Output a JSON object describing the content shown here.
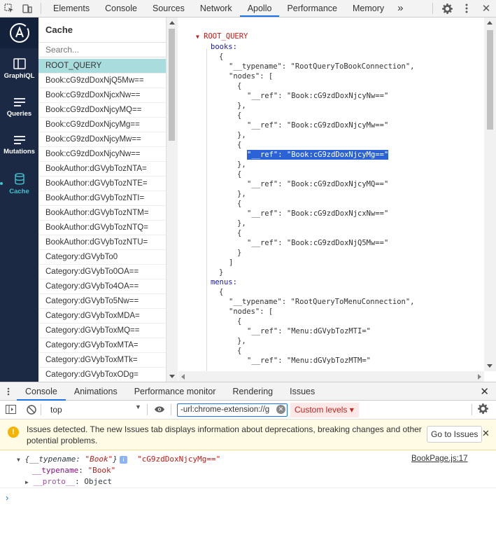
{
  "devtools": {
    "tabs": [
      "Elements",
      "Console",
      "Sources",
      "Network",
      "Apollo",
      "Performance",
      "Memory"
    ],
    "active_tab": "Apollo",
    "more_tabs": "»",
    "close": "✕"
  },
  "apollo_rail": {
    "items": [
      {
        "label": "GraphiQL",
        "icon": "graphiql-icon"
      },
      {
        "label": "Queries",
        "icon": "queries-icon"
      },
      {
        "label": "Mutations",
        "icon": "mutations-icon"
      },
      {
        "label": "Cache",
        "icon": "database-icon"
      }
    ],
    "active": "Cache"
  },
  "cache": {
    "title": "Cache",
    "search_placeholder": "Search...",
    "items": [
      "ROOT_QUERY",
      "Book:cG9zdDoxNjQ5Mw==",
      "Book:cG9zdDoxNjcxNw==",
      "Book:cG9zdDoxNjcyMQ==",
      "Book:cG9zdDoxNjcyMg==",
      "Book:cG9zdDoxNjcyMw==",
      "Book:cG9zdDoxNjcyNw==",
      "BookAuthor:dGVybTozNTA=",
      "BookAuthor:dGVybTozNTE=",
      "BookAuthor:dGVybTozNTI=",
      "BookAuthor:dGVybTozNTM=",
      "BookAuthor:dGVybTozNTQ=",
      "BookAuthor:dGVybTozNTU=",
      "Category:dGVybTo0",
      "Category:dGVybTo0OA==",
      "Category:dGVybTo4OA==",
      "Category:dGVybTo5Nw==",
      "Category:dGVybToxMDA=",
      "Category:dGVybToxMQ==",
      "Category:dGVybToxMTA=",
      "Category:dGVybToxMTk=",
      "Category:dGVybToxODg="
    ],
    "selected": "ROOT_QUERY"
  },
  "json_view": {
    "root": "ROOT_QUERY",
    "books_key": "books:",
    "books_typename": "\"__typename\": \"RootQueryToBookConnection\",",
    "nodes_key": "\"nodes\": [",
    "book_refs": [
      "\"__ref\": \"Book:cG9zdDoxNjcyNw==\"",
      "\"__ref\": \"Book:cG9zdDoxNjcyMw==\"",
      "\"__ref\": \"Book:cG9zdDoxNjcyMg==\"",
      "\"__ref\": \"Book:cG9zdDoxNjcyMQ==\"",
      "\"__ref\": \"Book:cG9zdDoxNjcxNw==\"",
      "\"__ref\": \"Book:cG9zdDoxNjQ5Mw==\""
    ],
    "highlighted_index": 2,
    "menus_key": "menus:",
    "menus_typename": "\"__typename\": \"RootQueryToMenuConnection\",",
    "menu_refs": [
      "\"__ref\": \"Menu:dGVybTozMTI=\"",
      "\"__ref\": \"Menu:dGVybTozMTM=\""
    ],
    "open_brace": "{",
    "close_brace": "},",
    "close_brace_last": "}",
    "close_bracket": "]"
  },
  "drawer": {
    "tabs": [
      "Console",
      "Animations",
      "Performance monitor",
      "Rendering",
      "Issues"
    ],
    "active": "Console"
  },
  "console_toolbar": {
    "context": "top",
    "filter_value": "-url:chrome-extension://g",
    "levels": "Custom levels ▾"
  },
  "issues_banner": {
    "text": "Issues detected. The new Issues tab displays information about deprecations, breaking changes and other potential problems.",
    "button": "Go to Issues"
  },
  "console_output": {
    "object_summary_open": "{__typename: ",
    "object_summary_type": "\"Book\"",
    "object_summary_close": "}",
    "logged_string": "\"cG9zdDoxNjcyMg==\"",
    "source": "BookPage.js:17",
    "prop_typename_key": "__typename",
    "prop_typename_value": "\"Book\"",
    "proto_key": "__proto__",
    "proto_value": "Object"
  },
  "colors": {
    "rail_bg": "#1c2945",
    "rail_accent": "#3fc3ce",
    "selected_row": "#a9dcdc",
    "highlight": "#2b62d6",
    "tab_underline": "#1a73e8"
  }
}
